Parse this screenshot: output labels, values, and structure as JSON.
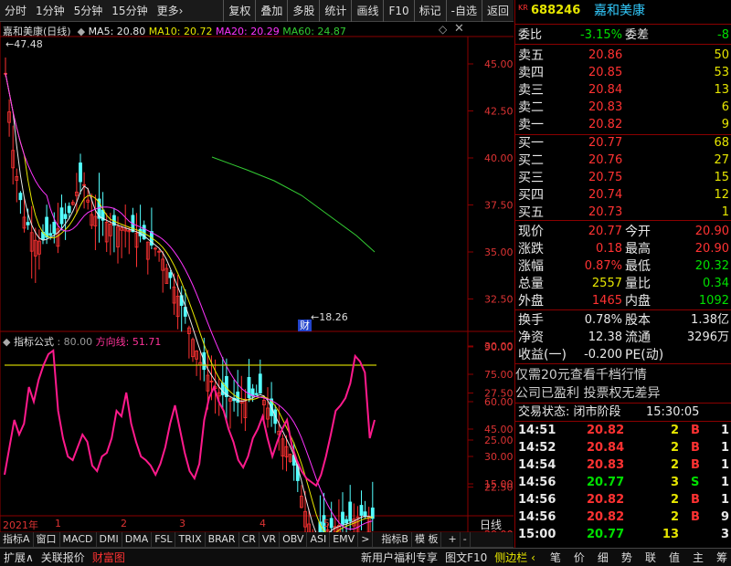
{
  "toolbar": {
    "left": [
      "分时",
      "1分钟",
      "5分钟",
      "15分钟",
      "更多›"
    ],
    "right": [
      "复权",
      "叠加",
      "多股",
      "统计",
      "画线",
      "F10",
      "标记",
      "-自选",
      "返回"
    ]
  },
  "stock": {
    "tag": "KR",
    "code": "688246",
    "name": "嘉和美康"
  },
  "main_chart": {
    "title": "嘉和美康(日线)",
    "ma": [
      {
        "label": "MA5: 20.80",
        "color": "#e8e8e8"
      },
      {
        "label": "MA10: 20.72",
        "color": "#e6e600"
      },
      {
        "label": "MA20: 20.29",
        "color": "#ff33ff"
      },
      {
        "label": "MA60: 24.87",
        "color": "#33cc33"
      }
    ],
    "high_label": "47.48",
    "low_label": "18.26",
    "marker": "财",
    "axis": [
      "45.00",
      "42.50",
      "40.00",
      "37.50",
      "35.00",
      "32.50",
      "30.00",
      "27.50",
      "25.00",
      "22.50",
      "20.00"
    ]
  },
  "indicator": {
    "name": "指标公式",
    "values": [
      {
        "label": ": 80.00",
        "color": "#999999"
      },
      {
        "label": "方向线: 51.71",
        "color": "#ff3399"
      }
    ],
    "axis": [
      "90.00",
      "75.00",
      "60.00",
      "45.00",
      "30.00",
      "15.00"
    ]
  },
  "timeaxis": {
    "year": "2021年",
    "months": [
      "1",
      "2",
      "3",
      "4",
      "5"
    ],
    "period": "日线"
  },
  "tabs": [
    "指标A",
    "窗口",
    "MACD",
    "DMI",
    "DMA",
    "FSL",
    "TRIX",
    "BRAR",
    "CR",
    "VR",
    "OBV",
    "ASI",
    "EMV",
    ">",
    "指标B",
    "模 板",
    "+",
    "-"
  ],
  "bottom_left": [
    "扩展∧",
    "关联报价",
    "财富图"
  ],
  "bottom_mid": [
    "新用户福利专享",
    "图文F10",
    "侧边栏 ‹"
  ],
  "bottom_right": [
    "笔",
    "价",
    "细",
    "势",
    "联",
    "值",
    "主",
    "筹"
  ],
  "quote": {
    "wei_bi_label": "委比",
    "wei_bi": "-3.15%",
    "wei_cha_label": "委差",
    "wei_cha": "-8",
    "sell": [
      {
        "label": "卖五",
        "price": "20.86",
        "vol": "50"
      },
      {
        "label": "卖四",
        "price": "20.85",
        "vol": "53"
      },
      {
        "label": "卖三",
        "price": "20.84",
        "vol": "13"
      },
      {
        "label": "卖二",
        "price": "20.83",
        "vol": "6"
      },
      {
        "label": "卖一",
        "price": "20.82",
        "vol": "9"
      }
    ],
    "buy": [
      {
        "label": "买一",
        "price": "20.77",
        "vol": "68"
      },
      {
        "label": "买二",
        "price": "20.76",
        "vol": "27"
      },
      {
        "label": "买三",
        "price": "20.75",
        "vol": "15"
      },
      {
        "label": "买四",
        "price": "20.74",
        "vol": "12"
      },
      {
        "label": "买五",
        "price": "20.73",
        "vol": "1"
      }
    ],
    "stats": [
      {
        "l1": "现价",
        "v1": "20.77",
        "c1": "red",
        "l2": "今开",
        "v2": "20.90",
        "c2": "red"
      },
      {
        "l1": "涨跌",
        "v1": "0.18",
        "c1": "red",
        "l2": "最高",
        "v2": "20.90",
        "c2": "red"
      },
      {
        "l1": "涨幅",
        "v1": "0.87%",
        "c1": "red",
        "l2": "最低",
        "v2": "20.32",
        "c2": "green"
      },
      {
        "l1": "总量",
        "v1": "2557",
        "c1": "yellow",
        "l2": "量比",
        "v2": "0.34",
        "c2": "green"
      },
      {
        "l1": "外盘",
        "v1": "1465",
        "c1": "red",
        "l2": "内盘",
        "v2": "1092",
        "c2": "green"
      }
    ],
    "stats2": [
      {
        "l1": "换手",
        "v1": "0.78%",
        "l2": "股本",
        "v2": "1.38亿"
      },
      {
        "l1": "净资",
        "v1": "12.38",
        "l2": "流通",
        "v2": "3296万"
      },
      {
        "l1": "收益(一)",
        "v1": "-0.200",
        "l2": "PE(动)",
        "v2": ""
      }
    ],
    "promo1": "仅需20元查看千档行情",
    "promo2": "公司已盈利 投票权无差异",
    "status_label": "交易状态: 闭市阶段",
    "status_time": "15:30:05",
    "ticks": [
      {
        "time": "14:51",
        "price": "20.82",
        "vol": "2",
        "bs": "B",
        "n": "1"
      },
      {
        "time": "14:52",
        "price": "20.84",
        "vol": "2",
        "bs": "B",
        "n": "1"
      },
      {
        "time": "14:54",
        "price": "20.83",
        "vol": "2",
        "bs": "B",
        "n": "1"
      },
      {
        "time": "14:56",
        "price": "20.77",
        "vol": "3",
        "bs": "S",
        "n": "1"
      },
      {
        "time": "14:56",
        "price": "20.82",
        "vol": "2",
        "bs": "B",
        "n": "1"
      },
      {
        "time": "14:56",
        "price": "20.82",
        "vol": "2",
        "bs": "B",
        "n": "9"
      },
      {
        "time": "15:00",
        "price": "20.77",
        "vol": "13",
        "bs": "",
        "n": "3"
      }
    ]
  }
}
